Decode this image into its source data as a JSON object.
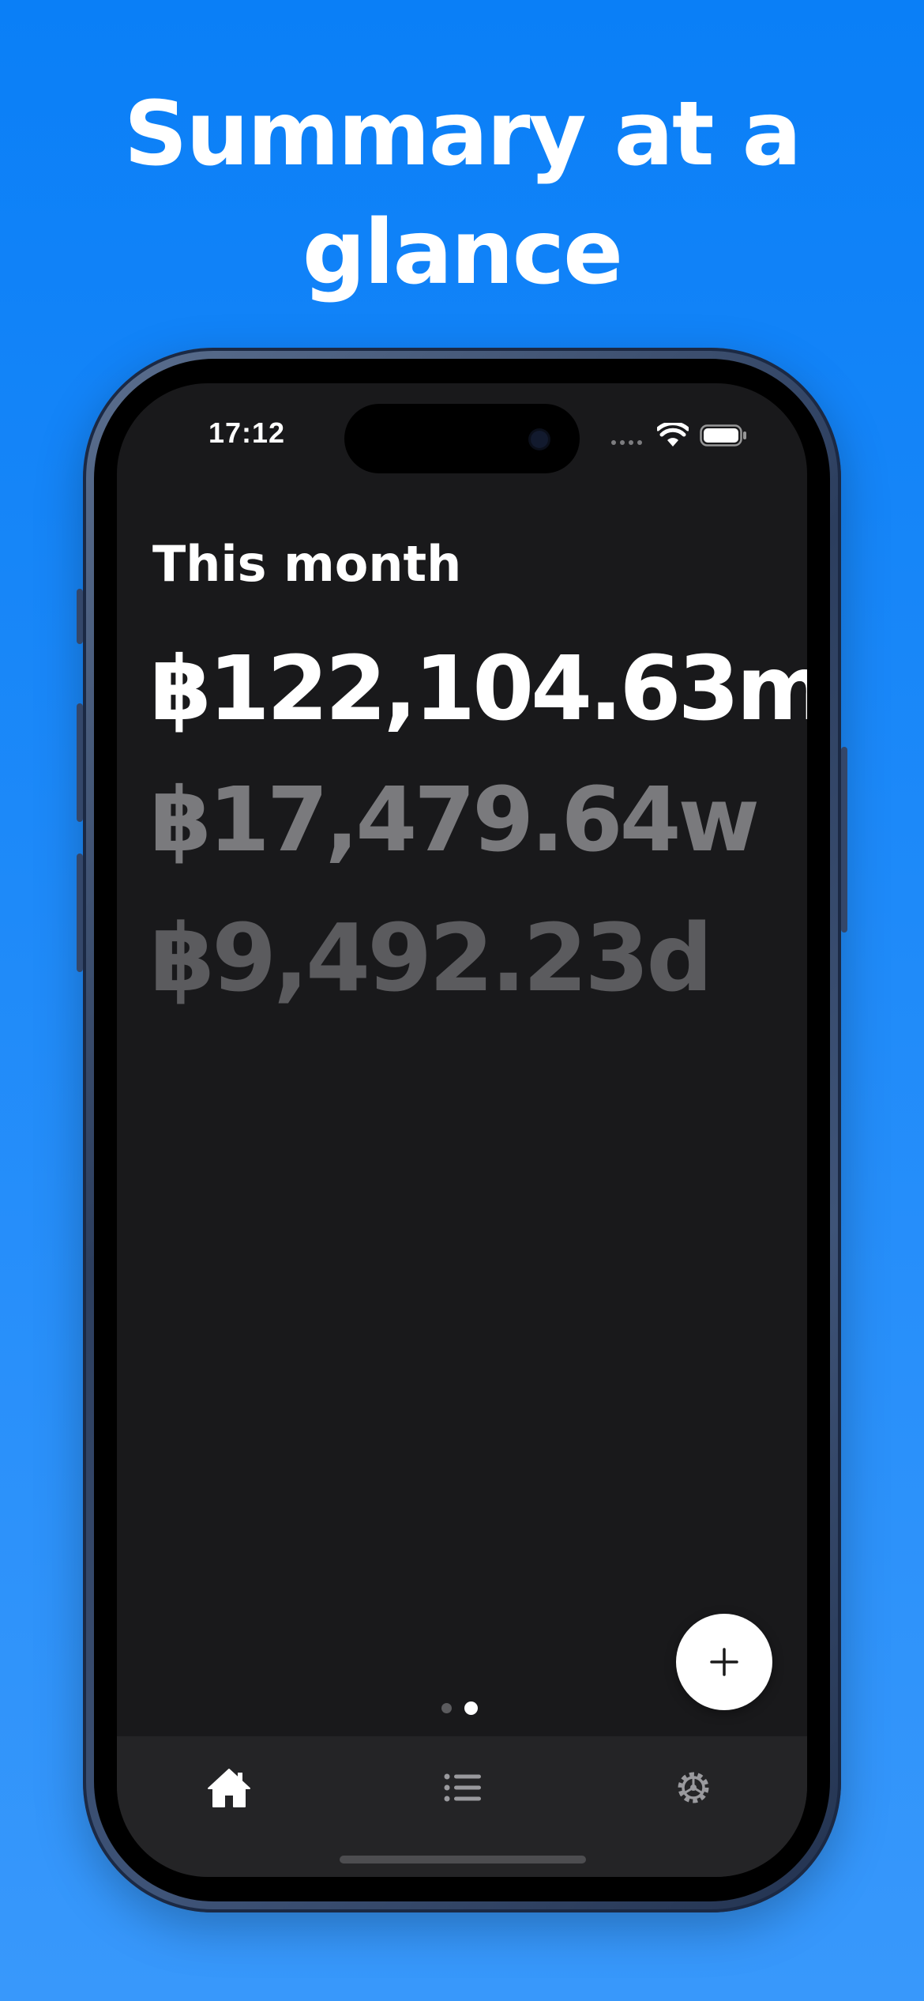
{
  "headline": {
    "line1": "Summary at a",
    "line2": "glance"
  },
  "status_bar": {
    "time": "17:12"
  },
  "summary": {
    "label": "This month",
    "amounts": {
      "per_month": "฿122,104.63m",
      "per_week": "฿17,479.64w",
      "per_day": "฿9,492.23d"
    }
  },
  "pager": {
    "page_count": 2,
    "active_page": 2
  },
  "actions": {
    "add_icon": "plus-icon"
  },
  "tab_bar": {
    "tabs": [
      {
        "icon": "house-icon",
        "selected": true
      },
      {
        "icon": "list-icon",
        "selected": false
      },
      {
        "icon": "gear-icon",
        "selected": false
      }
    ]
  },
  "colors": {
    "background_top": "#0a7ff7",
    "background_bottom": "#3898fb",
    "screen": "#19191b",
    "tab_bar": "#242426",
    "primary_text": "#ffffff",
    "secondary_amount": "#7a7a7d",
    "tertiary_amount": "#5b5b5e"
  }
}
